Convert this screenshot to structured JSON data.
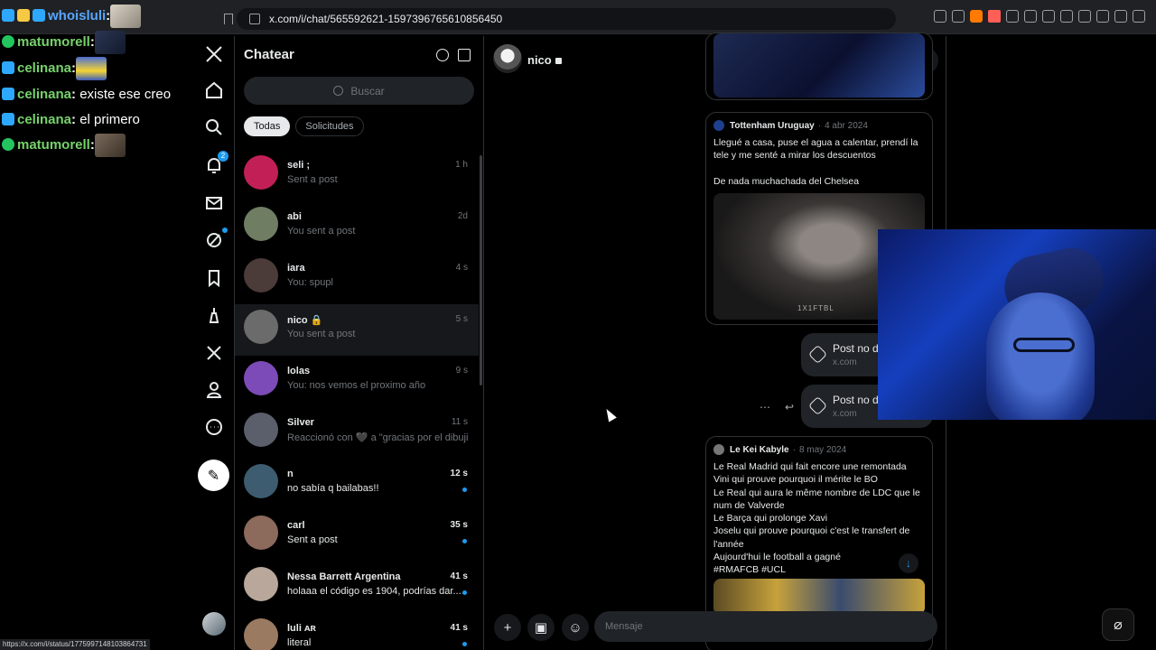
{
  "browser": {
    "url": "x.com/i/chat/565592621-1597396765610856450",
    "status_url": "https://x.com/i/status/1775997148103864731"
  },
  "overlay_chat": [
    {
      "name": "whoisluli",
      "suffix": ":",
      "message": "",
      "emote": "cat",
      "color": "blue"
    },
    {
      "name": "matumorell",
      "suffix": ":",
      "message": "",
      "emote": "dark",
      "color": "green"
    },
    {
      "name": "celinana",
      "suffix": ":",
      "message": "",
      "emote": "minion",
      "color": "green"
    },
    {
      "name": "celinana",
      "suffix": ":",
      "message": " existe ese creo",
      "emote": "",
      "color": "green"
    },
    {
      "name": "celinana",
      "suffix": ":",
      "message": " el primero",
      "emote": "",
      "color": "green"
    },
    {
      "name": "matumorell",
      "suffix": ":",
      "message": "",
      "emote": "photo",
      "color": "green"
    }
  ],
  "nav": {
    "notification_count": "2"
  },
  "conversations_panel": {
    "title": "Chatear",
    "search_placeholder": "Buscar",
    "tabs": [
      "Todas",
      "Solicitudes"
    ],
    "items": [
      {
        "name": "seli ;",
        "preview": "Sent a post",
        "time": "1 h",
        "unread": false,
        "avatar": "#c21f57"
      },
      {
        "name": "abi",
        "preview": "You sent a post",
        "time": "2d",
        "unread": false,
        "avatar": "#6f7d63"
      },
      {
        "name": "iara",
        "preview": "You: spupl",
        "time": "4 s",
        "unread": false,
        "avatar": "#4b3b39"
      },
      {
        "name": "nico 🔒",
        "preview": "You sent a post",
        "time": "5 s",
        "unread": false,
        "avatar": "#6b6b6b"
      },
      {
        "name": "lolas",
        "preview": "You: nos vemos el proximo año",
        "time": "9 s",
        "unread": false,
        "avatar": "#7d4bb8"
      },
      {
        "name": "Silver",
        "preview": "Reaccionó con 🖤 a \"gracias por el dibujit...",
        "time": "11 s",
        "unread": false,
        "avatar": "#5a5f6b"
      },
      {
        "name": "n",
        "preview": "no sabía q bailabas!!",
        "time": "12 s",
        "unread": true,
        "avatar": "#3d5c6f"
      },
      {
        "name": "carl",
        "preview": "Sent a post",
        "time": "35 s",
        "unread": true,
        "avatar": "#8c6a5c"
      },
      {
        "name": "Nessa Barrett Argentina",
        "preview": "holaaa el código es 1904, podrías dar...",
        "time": "41 s",
        "unread": true,
        "avatar": "#b8a79a"
      },
      {
        "name": "luli ᴀʀ",
        "preview": "literal",
        "time": "41 s",
        "unread": true,
        "avatar": "#9b7a62"
      }
    ]
  },
  "chat": {
    "contact_name": "nico",
    "messages": {
      "post1": {
        "author": "Tottenham Uruguay",
        "date": "4 abr 2024",
        "text": "Llegué a casa, puse el agua a calentar, prendí la tele y me senté a mirar los descuentos\n\nDe nada muchachada del Chelsea",
        "watermark": "1X1FTBL"
      },
      "link1": {
        "title": "Post no d",
        "domain": "x.com"
      },
      "link2": {
        "title": "Post no d",
        "domain": "x.com"
      },
      "post2": {
        "author": "Le Kei Kabyle",
        "date": "8 may 2024",
        "text": "Le Real Madrid qui fait encore une remontada\nVini qui prouve pourquoi il mérite le BO\nLe Real qui aura le même nombre de LDC que le num de Valverde\nLe Barça qui prolonge Xavi\nJoselu qui prouve pourquoi c'est le transfert de l'année\nAujourd'hui le football a gagné\n#RMAFCB #UCL"
      }
    },
    "composer_placeholder": "Mensaje"
  }
}
